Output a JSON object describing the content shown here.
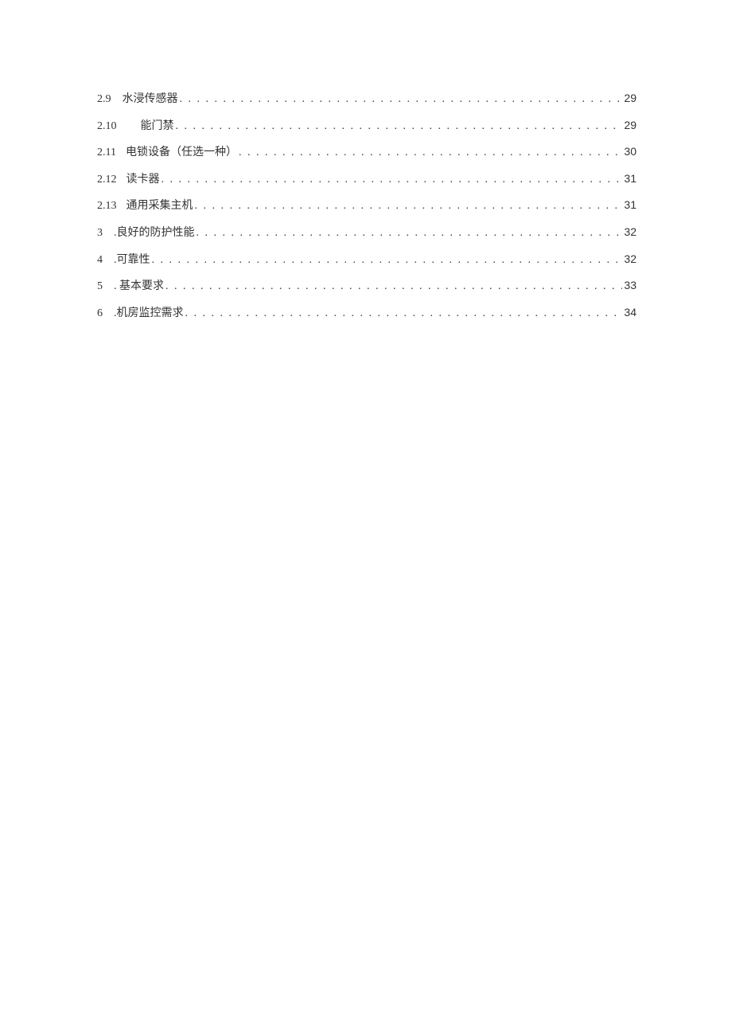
{
  "toc": [
    {
      "num": "2.9",
      "gap": 14,
      "title": "水浸传感器",
      "page": "29"
    },
    {
      "num": "2.10",
      "gap": 30,
      "title": "能门禁",
      "page": "29"
    },
    {
      "num": "2.11",
      "gap": 12,
      "title": "电锁设备（任选一种）",
      "page": "30"
    },
    {
      "num": "2.12",
      "gap": 12,
      "title": "读卡器",
      "page": "31"
    },
    {
      "num": "2.13",
      "gap": 12,
      "title": "通用采集主机",
      "page": "31"
    },
    {
      "num": "3",
      "gap": 14,
      "title": ".良好的防护性能",
      "page": "32"
    },
    {
      "num": "4",
      "gap": 14,
      "title": ".可靠性",
      "page": "32"
    },
    {
      "num": "5",
      "gap": 14,
      "title": ". 基本要求",
      "page": "33"
    },
    {
      "num": "6",
      "gap": 14,
      "title": ".机房监控需求",
      "page": "34"
    }
  ]
}
